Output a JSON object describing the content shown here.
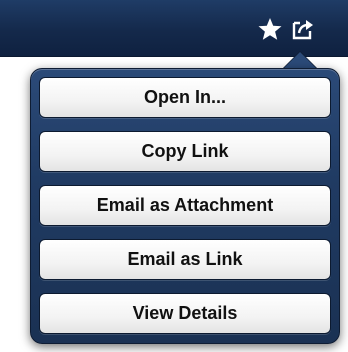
{
  "navbar": {
    "icons": [
      "star-icon",
      "share-icon"
    ]
  },
  "popover": {
    "items": [
      {
        "label": "Open In..."
      },
      {
        "label": "Copy Link"
      },
      {
        "label": "Email as Attachment"
      },
      {
        "label": "Email as Link"
      },
      {
        "label": "View Details"
      }
    ]
  },
  "colors": {
    "navbar": "#14294b",
    "popover": "#203b63",
    "button": "#f3f3f3",
    "text": "#111111"
  }
}
